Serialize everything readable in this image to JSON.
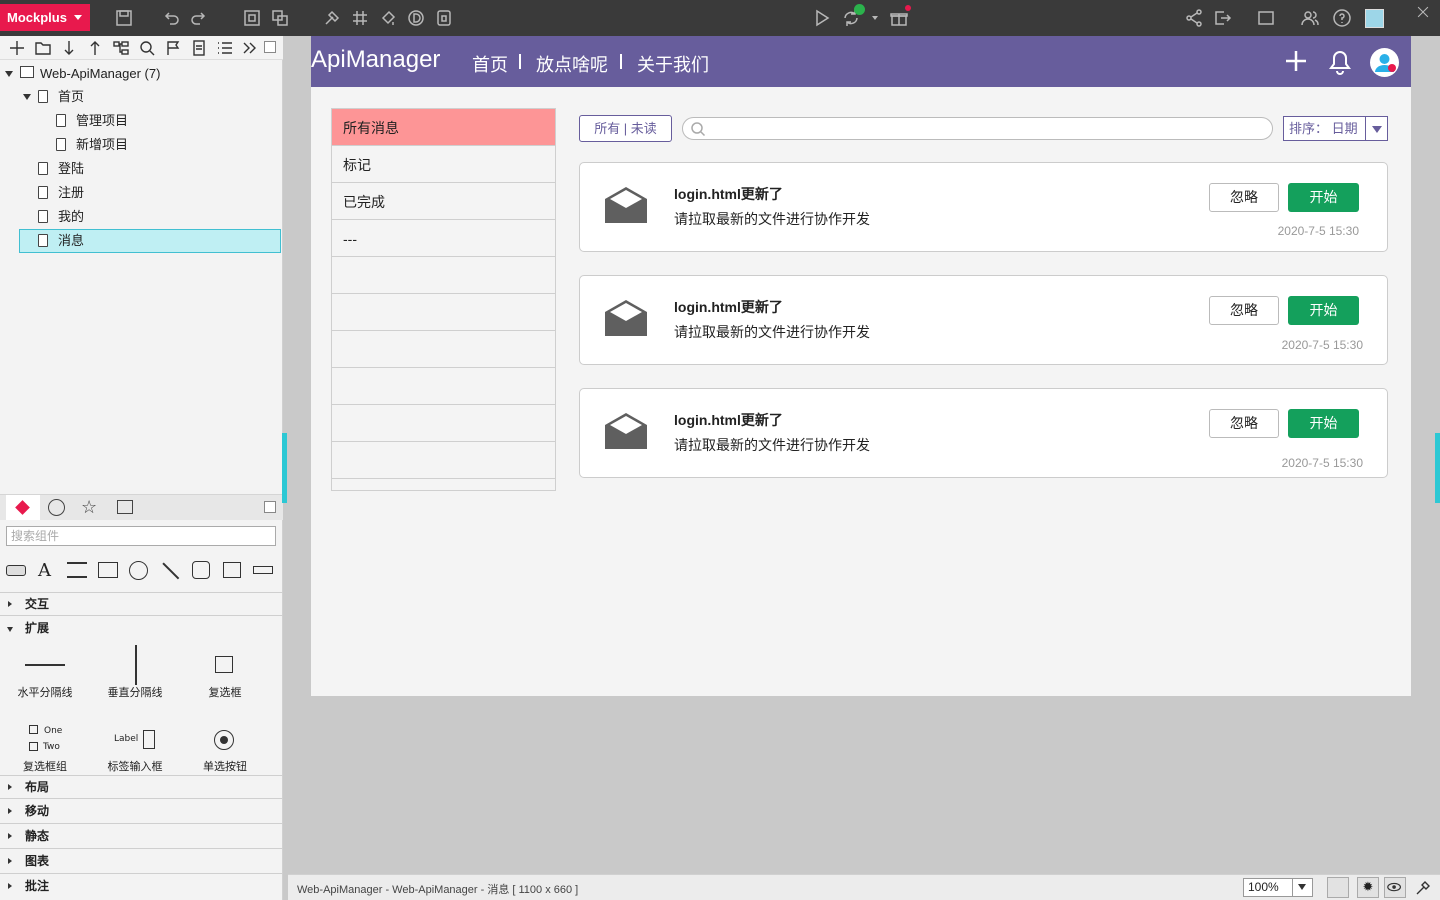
{
  "topbar": {
    "logo": "Mockplus"
  },
  "tree": {
    "root": "Web-ApiManager (7)",
    "items": [
      {
        "label": "首页"
      },
      {
        "label": "管理项目"
      },
      {
        "label": "新增项目"
      },
      {
        "label": "登陆"
      },
      {
        "label": "注册"
      },
      {
        "label": "我的"
      },
      {
        "label": "消息"
      }
    ]
  },
  "components": {
    "search_placeholder": "搜索组件",
    "sections": {
      "interaction": "交互",
      "extension": "扩展",
      "layout": "布局",
      "mobile": "移动",
      "static": "静态",
      "chart": "图表",
      "annotation": "批注"
    },
    "items": [
      "水平分隔线",
      "垂直分隔线",
      "复选框",
      "复选框组",
      "标签输入框",
      "单选按钮"
    ],
    "checkbox_group_one": "One",
    "checkbox_group_two": "Two",
    "label_input_text": "Label"
  },
  "app": {
    "title": "ApiManager",
    "nav": [
      "首页",
      "放点啥呢",
      "关于我们"
    ]
  },
  "sidebar": [
    "所有消息",
    "标记",
    "已完成",
    "---"
  ],
  "filter": {
    "label": "所有 | 未读",
    "sort": "排序： 日期"
  },
  "messages": [
    {
      "title": "login.html更新了",
      "desc": "请拉取最新的文件进行协作开发",
      "ignore": "忽略",
      "start": "开始",
      "time": "2020-7-5 15:30"
    },
    {
      "title": "login.html更新了",
      "desc": "请拉取最新的文件进行协作开发",
      "ignore": "忽略",
      "start": "开始",
      "time": "2020-7-5 15:30"
    },
    {
      "title": "login.html更新了",
      "desc": "请拉取最新的文件进行协作开发",
      "ignore": "忽略",
      "start": "开始",
      "time": "2020-7-5 15:30"
    }
  ],
  "status": {
    "text": "Web-ApiManager - Web-ApiManager - 消息 [ 1100 x 660 ]",
    "zoom": "100%"
  },
  "colors": {
    "brand": "#e8194d",
    "header": "#675d9c",
    "active_nav": "#fd9596",
    "start_button": "#14a05c",
    "selection": "#bfeff3"
  }
}
